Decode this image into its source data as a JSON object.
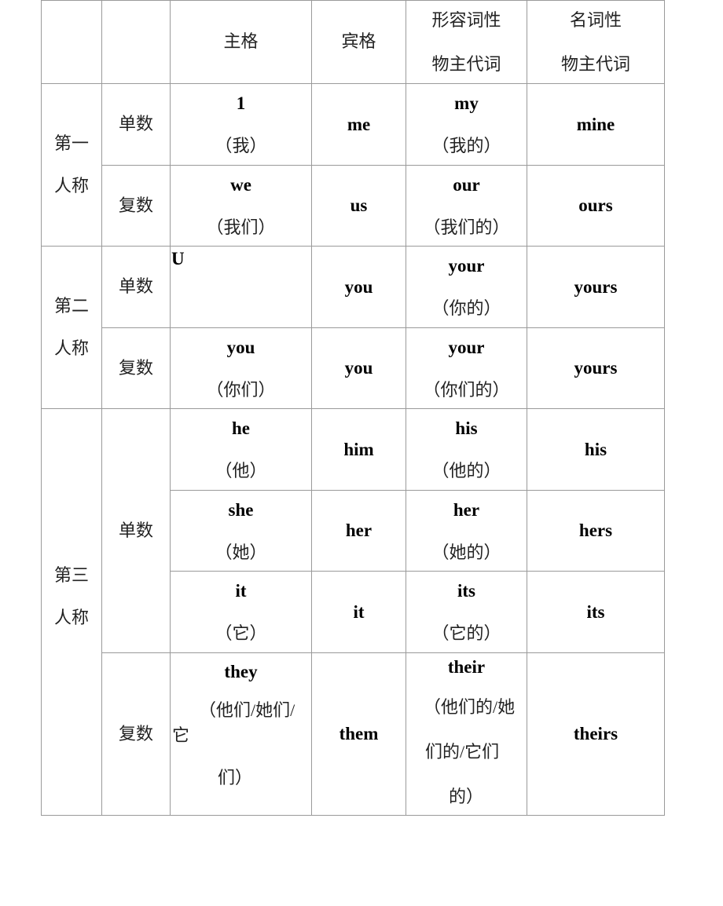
{
  "headers": {
    "blank1": "",
    "blank2": "",
    "subject": "主格",
    "object": "宾格",
    "adj_possessive": [
      "形容词性",
      "物主代词"
    ],
    "noun_possessive": [
      "名词性",
      "物主代词"
    ]
  },
  "groups": {
    "first": [
      "第一",
      "人称"
    ],
    "second": [
      "第二",
      "人称"
    ],
    "third": [
      "第三",
      "人称"
    ]
  },
  "number": {
    "singular": "单数",
    "plural": "复数"
  },
  "rows": {
    "first_singular": {
      "subject": "1",
      "subject_zh": "（我）",
      "object": "me",
      "adj": "my",
      "adj_zh": "（我的）",
      "noun": "mine"
    },
    "first_plural": {
      "subject": "we",
      "subject_zh": "（我们）",
      "object": "us",
      "adj": "our",
      "adj_zh": "（我们的）",
      "noun": "ours"
    },
    "second_singular": {
      "subject": "U",
      "object": "you",
      "adj": "your",
      "adj_zh": "（你的）",
      "noun": "yours"
    },
    "second_plural": {
      "subject": "you",
      "subject_zh": "（你们）",
      "object": "you",
      "adj": "your",
      "adj_zh": "（你们的）",
      "noun": "yours"
    },
    "third_he": {
      "subject": "he",
      "subject_zh": "（他）",
      "object": "him",
      "adj": "his",
      "adj_zh": "（他的）",
      "noun": "his"
    },
    "third_she": {
      "subject": "she",
      "subject_zh": "（她）",
      "object": "her",
      "adj": "her",
      "adj_zh": "（她的）",
      "noun": "hers"
    },
    "third_it": {
      "subject": "it",
      "subject_zh": "（它）",
      "object": "it",
      "adj": "its",
      "adj_zh": "（它的）",
      "noun": "its"
    },
    "third_plural": {
      "subject": "they",
      "subject_zh_lines": [
        "（他们/她们/",
        "它",
        "们）"
      ],
      "object": "them",
      "adj": "their",
      "adj_zh_lines": [
        "（他们的/她",
        "们的/它们",
        "的）"
      ],
      "noun": "theirs"
    }
  }
}
